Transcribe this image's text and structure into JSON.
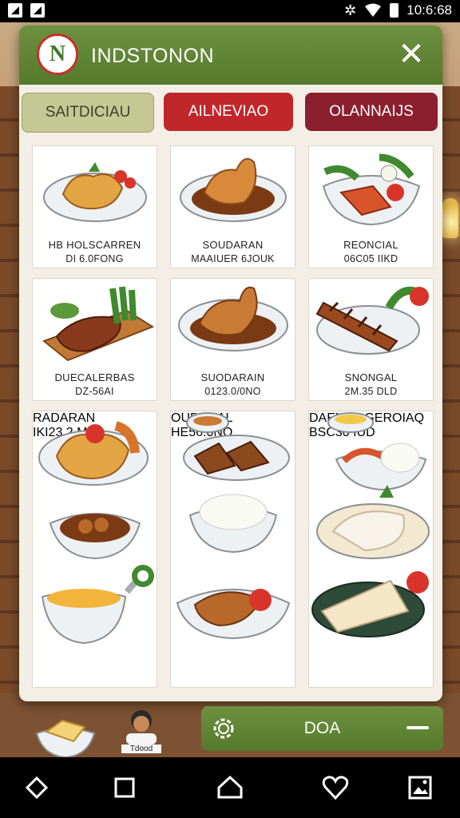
{
  "status_bar": {
    "time": "10:6:68",
    "icons": [
      "notification-icon",
      "image-icon",
      "bluetooth-icon",
      "wifi-icon",
      "battery-icon"
    ]
  },
  "header": {
    "logo_text": "N",
    "title": "INDSTONON",
    "close_glyph": "✕"
  },
  "tabs": [
    {
      "label": "SAITDICIAU",
      "color": "#c4c993"
    },
    {
      "label": "AILNEVIAO",
      "color": "#c0272a"
    },
    {
      "label": "OLANNAIJS",
      "color": "#8c1f2e"
    }
  ],
  "dishes": [
    {
      "name": "HB HOLSCARREN",
      "price": "DI 6.0FONG"
    },
    {
      "name": "SOUDARAN",
      "price": "MAAIUER 6JOUK"
    },
    {
      "name": "REONCIAL",
      "price": "06C05 IIKD"
    },
    {
      "name": "DUECALERBAS",
      "price": "DZ-56AI"
    },
    {
      "name": "SUODARAIN",
      "price": "0123.0/0NO"
    },
    {
      "name": "SNONGAL",
      "price": "2M.35 DLD"
    },
    {
      "name": "RADARAN",
      "price": "IKI23.2.M9"
    },
    {
      "name": "OUDREAL",
      "price": "HE56.0NO"
    },
    {
      "name": "DAENOOGEROIAQ",
      "price": "BSC30 IUD"
    }
  ],
  "bottom": {
    "tray_label": "Tdood",
    "cart_label": "DOA"
  },
  "navbar": {
    "items": [
      "back-icon",
      "recents-icon",
      "home-icon",
      "favorite-icon",
      "gallery-icon"
    ]
  },
  "colors": {
    "brand_green": "#5f8436",
    "tab_red": "#c0272a",
    "tab_maroon": "#8c1f2e"
  }
}
